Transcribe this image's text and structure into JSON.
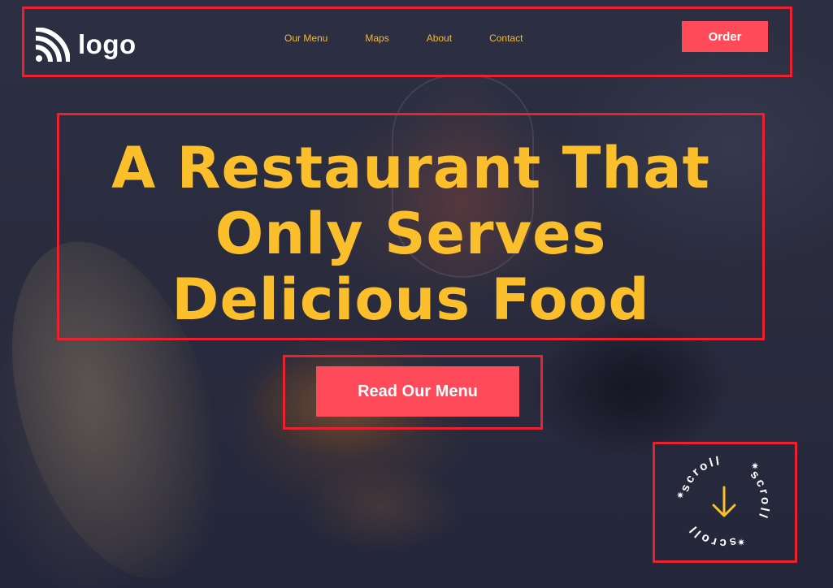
{
  "logo": {
    "text": "logo",
    "icon": "rss-wave-icon"
  },
  "nav": {
    "items": [
      {
        "label": "Our Menu"
      },
      {
        "label": "Maps"
      },
      {
        "label": "About"
      },
      {
        "label": "Contact"
      }
    ]
  },
  "header": {
    "order_label": "Order"
  },
  "hero": {
    "title_lines": [
      "A Restaurant That",
      "Only Serves",
      "Delicious Food"
    ],
    "cta_label": "Read Our Menu"
  },
  "scroll": {
    "label": "scroll",
    "icon": "arrow-down-icon",
    "star_icon": "sparkle-icon"
  },
  "colors": {
    "accent_yellow": "#fbbf2c",
    "accent_red": "#ff4a5a",
    "background": "#2a2c3d",
    "annotation": "#e8232f"
  }
}
